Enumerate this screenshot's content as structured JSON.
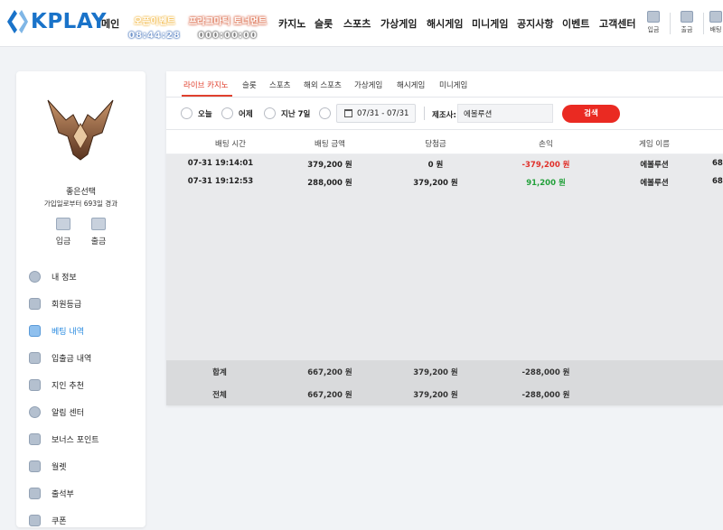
{
  "header": {
    "logo_text": "KPLAY",
    "nav": [
      "메인",
      "카지노",
      "슬롯",
      "스포츠",
      "가상게임",
      "해시게임",
      "미니게임",
      "공지사항",
      "이벤트",
      "고객센터"
    ],
    "promo1": {
      "title": "오픈이벤트",
      "countdown": "08:44:28"
    },
    "promo2": {
      "title": "프라그마틱 토너먼트",
      "countdown": "000:00:00"
    },
    "quick": [
      "입금",
      "출금",
      "배팅"
    ]
  },
  "sidebar": {
    "username": "좋은선택",
    "joined": "가입일로부터 693일 경과",
    "deposit_label": "입금",
    "withdraw_label": "출금",
    "menu": [
      {
        "label": "내 정보",
        "icon": "user-icon"
      },
      {
        "label": "회원등급",
        "icon": "rank-icon"
      },
      {
        "label": "베팅 내역",
        "icon": "betting-history-icon",
        "active": true
      },
      {
        "label": "입출금 내역",
        "icon": "transaction-icon"
      },
      {
        "label": "지인 추천",
        "icon": "referral-icon"
      },
      {
        "label": "알림 센터",
        "icon": "notification-icon"
      },
      {
        "label": "보너스 포인트",
        "icon": "bonus-icon"
      },
      {
        "label": "월렛",
        "icon": "wallet-icon"
      },
      {
        "label": "출석부",
        "icon": "attendance-icon"
      },
      {
        "label": "쿠폰",
        "icon": "coupon-icon"
      }
    ]
  },
  "main": {
    "tabs": [
      "라이브 카지노",
      "슬롯",
      "스포츠",
      "해외 스포츠",
      "가상게임",
      "해시게임",
      "미니게임"
    ],
    "filters": {
      "options": [
        "오늘",
        "어제",
        "지난 7일"
      ],
      "date_range": "07/31 - 07/31",
      "provider_label": "제조사:",
      "provider_value": "에볼루션",
      "search_label": "검색"
    },
    "columns": [
      "배팅 시간",
      "배팅 금액",
      "당첨금",
      "손익",
      "게임 이름"
    ],
    "rows": [
      {
        "time": "07-31 19:14:01",
        "bet": "379,200 원",
        "win": "0 원",
        "pl": "-379,200 원",
        "game": "에볼루션",
        "extra": "68"
      },
      {
        "time": "07-31 19:12:53",
        "bet": "288,000 원",
        "win": "379,200 원",
        "pl": "91,200 원",
        "game": "에볼루션",
        "extra": "68"
      }
    ],
    "subtotal": {
      "label": "합계",
      "bet": "667,200 원",
      "win": "379,200 원",
      "pl": "-288,000 원"
    },
    "total": {
      "label": "전체",
      "bet": "667,200 원",
      "win": "379,200 원",
      "pl": "-288,000 원"
    }
  },
  "colors": {
    "brand": "#1a73c9",
    "accent": "#ea2a22",
    "negative": "#e0302a",
    "positive": "#22a03a",
    "active_menu": "#2a8be0"
  }
}
